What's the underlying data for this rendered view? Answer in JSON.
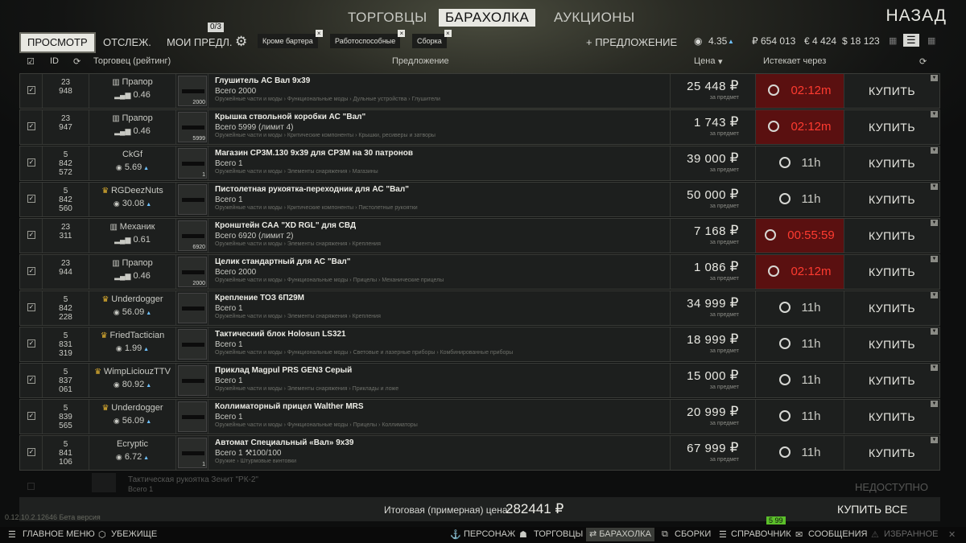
{
  "nav": {
    "traders": "ТОРГОВЦЫ",
    "flea": "БАРАХОЛКА",
    "auctions": "АУКЦИОНЫ",
    "back": "НАЗАД"
  },
  "sub": {
    "browse": "ПРОСМОТР",
    "track": "ОТСЛЕЖ.",
    "my_offers": "МОИ ПРЕДЛ.",
    "counter": "0/3",
    "add_offer": "+ ПРЕДЛОЖЕНИЕ"
  },
  "filters": [
    "Кроме бартера",
    "Работоспособные",
    "Сборка"
  ],
  "balance": {
    "rating": "4.35",
    "rub": "₽ 654 013",
    "eur": "€ 4 424",
    "usd": "$ 18 123"
  },
  "header": {
    "id": "ID",
    "trader": "Торговец (рейтинг)",
    "offer": "Предложение",
    "price": "Цена",
    "expires": "Истекает через"
  },
  "rows": [
    {
      "id": "23\n948",
      "trader": "Прапор",
      "rating": "0.46",
      "name": "Глушитель АС Вал 9х39",
      "total": "Всего 2000",
      "cat": "Оружейные части и моды › Функциональные моды › Дульные устройства › Глушители",
      "qty": "2000",
      "price": "25 448",
      "exp": "02:12m",
      "red": true
    },
    {
      "id": "23\n947",
      "trader": "Прапор",
      "rating": "0.46",
      "name": "Крышка ствольной коробки АС \"Вал\"",
      "total": "Всего 5999  (лимит 4)",
      "cat": "Оружейные части и моды › Критические компоненты › Крышки, ресиверы и затворы",
      "qty": "5999",
      "price": "1 743",
      "exp": "02:12m",
      "red": true
    },
    {
      "id": "5\n842\n572",
      "trader": "CkGf",
      "rating": "5.69",
      "name": "Магазин СР3М.130 9х39 для СР3М на 30 патронов",
      "total": "Всего 1",
      "cat": "Оружейные части и моды › Элементы снаряжения › Магазины",
      "qty": "1",
      "price": "39 000",
      "exp": "11h",
      "red": false
    },
    {
      "id": "5\n842\n560",
      "trader": "RGDeezNuts",
      "rating": "30.08",
      "name": "Пистолетная рукоятка-переходник для АС \"Вал\"",
      "total": "Всего 1",
      "cat": "Оружейные части и моды › Критические компоненты › Пистолетные рукоятки",
      "qty": "",
      "price": "50 000",
      "exp": "11h",
      "red": false
    },
    {
      "id": "23\n311",
      "trader": "Механик",
      "rating": "0.61",
      "name": "Кронштейн САА \"XD RGL\" для СВД",
      "total": "Всего 6920  (лимит 2)",
      "cat": "Оружейные части и моды › Элементы снаряжения › Крепления",
      "qty": "6920",
      "price": "7 168",
      "exp": "00:55:59",
      "red": true
    },
    {
      "id": "23\n944",
      "trader": "Прапор",
      "rating": "0.46",
      "name": "Целик стандартный для АС \"Вал\"",
      "total": "Всего 2000",
      "cat": "Оружейные части и моды › Функциональные моды › Прицелы › Механические прицелы",
      "qty": "2000",
      "price": "1 086",
      "exp": "02:12m",
      "red": true
    },
    {
      "id": "5\n842\n228",
      "trader": "Underdogger",
      "rating": "56.09",
      "name": "Крепление ТОЗ 6П29М",
      "total": "Всего 1",
      "cat": "Оружейные части и моды › Элементы снаряжения › Крепления",
      "qty": "",
      "price": "34 999",
      "exp": "11h",
      "red": false
    },
    {
      "id": "5\n831\n319",
      "trader": "FriedTactician",
      "rating": "1.99",
      "name": "Тактический блок Holosun LS321",
      "total": "Всего 1",
      "cat": "Оружейные части и моды › Функциональные моды › Световые и лазерные приборы › Комбинированные приборы",
      "qty": "",
      "price": "18 999",
      "exp": "11h",
      "red": false
    },
    {
      "id": "5\n837\n061",
      "trader": "WimpLiciouzTTV",
      "rating": "80.92",
      "name": "Приклад Magpul PRS GEN3 Серый",
      "total": "Всего 1",
      "cat": "Оружейные части и моды › Элементы снаряжения › Приклады и ложе",
      "qty": "",
      "price": "15 000",
      "exp": "11h",
      "red": false
    },
    {
      "id": "5\n839\n565",
      "trader": "Underdogger",
      "rating": "56.09",
      "name": "Коллиматорный прицел Walther MRS",
      "total": "Всего 1",
      "cat": "Оружейные части и моды › Функциональные моды › Прицелы › Коллиматоры",
      "qty": "",
      "price": "20 999",
      "exp": "11h",
      "red": false
    },
    {
      "id": "5\n841\n106",
      "trader": "Ecryptic",
      "rating": "6.72",
      "name": "Автомат Специальный «Вал» 9х39",
      "total": "Всего 1  ⚒100/100",
      "cat": "Оружие › Штурмовые винтовки",
      "qty": "1",
      "price": "67 999",
      "exp": "11h",
      "red": false
    }
  ],
  "per_item": "за предмет",
  "buy": "КУПИТЬ",
  "ghost": {
    "name": "Тактическая рукоятка Зенит \"РК-2\"",
    "total": "Всего 1",
    "status": "НЕДОСТУПНО"
  },
  "bottom": {
    "total_label": "Итоговая (примерная) цена:",
    "total_value": "282441 ₽",
    "buy_all": "КУПИТЬ ВСЕ",
    "version": "0.12.10.2.12646 Бета версия",
    "ping": "5 99"
  },
  "taskbar": [
    "ГЛАВНОЕ МЕНЮ",
    "УБЕЖИЩЕ",
    "ПЕРСОНАЖ",
    "ТОРГОВЦЫ",
    "БАРАХОЛКА",
    "СБОРКИ",
    "СПРАВОЧНИК",
    "СООБЩЕНИЯ",
    "ИЗБРАННОЕ"
  ]
}
